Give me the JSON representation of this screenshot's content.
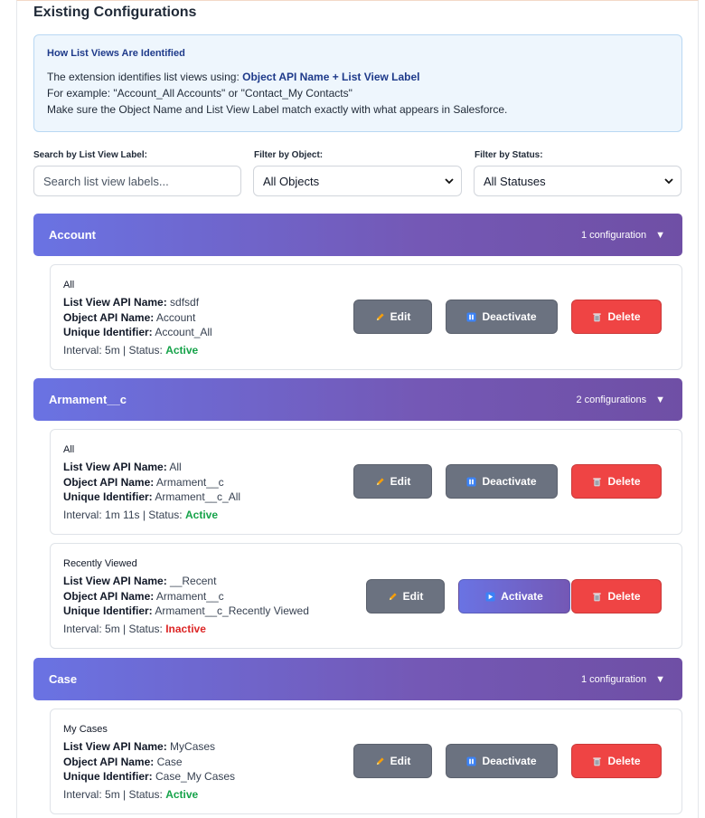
{
  "page_title": "Existing Configurations",
  "info": {
    "title": "How List Views Are Identified",
    "line1_prefix": "The extension identifies list views using: ",
    "line1_bold": "Object API Name + List View Label",
    "line2": "For example: \"Account_All Accounts\" or \"Contact_My Contacts\"",
    "line3": "Make sure the Object Name and List View Label match exactly with what appears in Salesforce."
  },
  "filters": {
    "search_label": "Search by List View Label:",
    "search_placeholder": "Search list view labels...",
    "object_label": "Filter by Object:",
    "object_value": "All Objects",
    "status_label": "Filter by Status:",
    "status_value": "All Statuses"
  },
  "labels": {
    "api_name": "List View API Name:",
    "object_api_name": "Object API Name:",
    "unique_identifier": "Unique Identifier:",
    "interval_prefix": "Interval: ",
    "status_sep": " | Status: "
  },
  "buttons": {
    "edit": "Edit",
    "deactivate": "Deactivate",
    "activate": "Activate",
    "delete": "Delete"
  },
  "colors": {
    "accent_start": "#6a73e3",
    "accent_end": "#6f4fa5",
    "active": "#16a34a",
    "inactive": "#dc2626",
    "delete": "#ef4444",
    "neutral_button": "#6b7280"
  },
  "groups": [
    {
      "name": "Account",
      "count": "1 configuration",
      "configs": [
        {
          "title": "All",
          "api_name": "sdfsdf",
          "object_api_name": "Account",
          "unique_identifier": "Account_All",
          "interval": "5m",
          "status": "Active"
        }
      ]
    },
    {
      "name": "Armament__c",
      "count": "2 configurations",
      "configs": [
        {
          "title": "All",
          "api_name": "All",
          "object_api_name": "Armament__c",
          "unique_identifier": "Armament__c_All",
          "interval": "1m 11s",
          "status": "Active"
        },
        {
          "title": "Recently Viewed",
          "api_name": "__Recent",
          "object_api_name": "Armament__c",
          "unique_identifier": "Armament__c_Recently Viewed",
          "interval": "5m",
          "status": "Inactive"
        }
      ]
    },
    {
      "name": "Case",
      "count": "1 configuration",
      "configs": [
        {
          "title": "My Cases",
          "api_name": "MyCases",
          "object_api_name": "Case",
          "unique_identifier": "Case_My Cases",
          "interval": "5m",
          "status": "Active"
        }
      ]
    }
  ],
  "icons": {
    "edit": "pencil-icon",
    "deactivate": "pause-icon",
    "activate": "play-icon",
    "delete": "trash-icon",
    "group_toggle": "triangle-down-icon",
    "select": "chevron-down-icon"
  }
}
